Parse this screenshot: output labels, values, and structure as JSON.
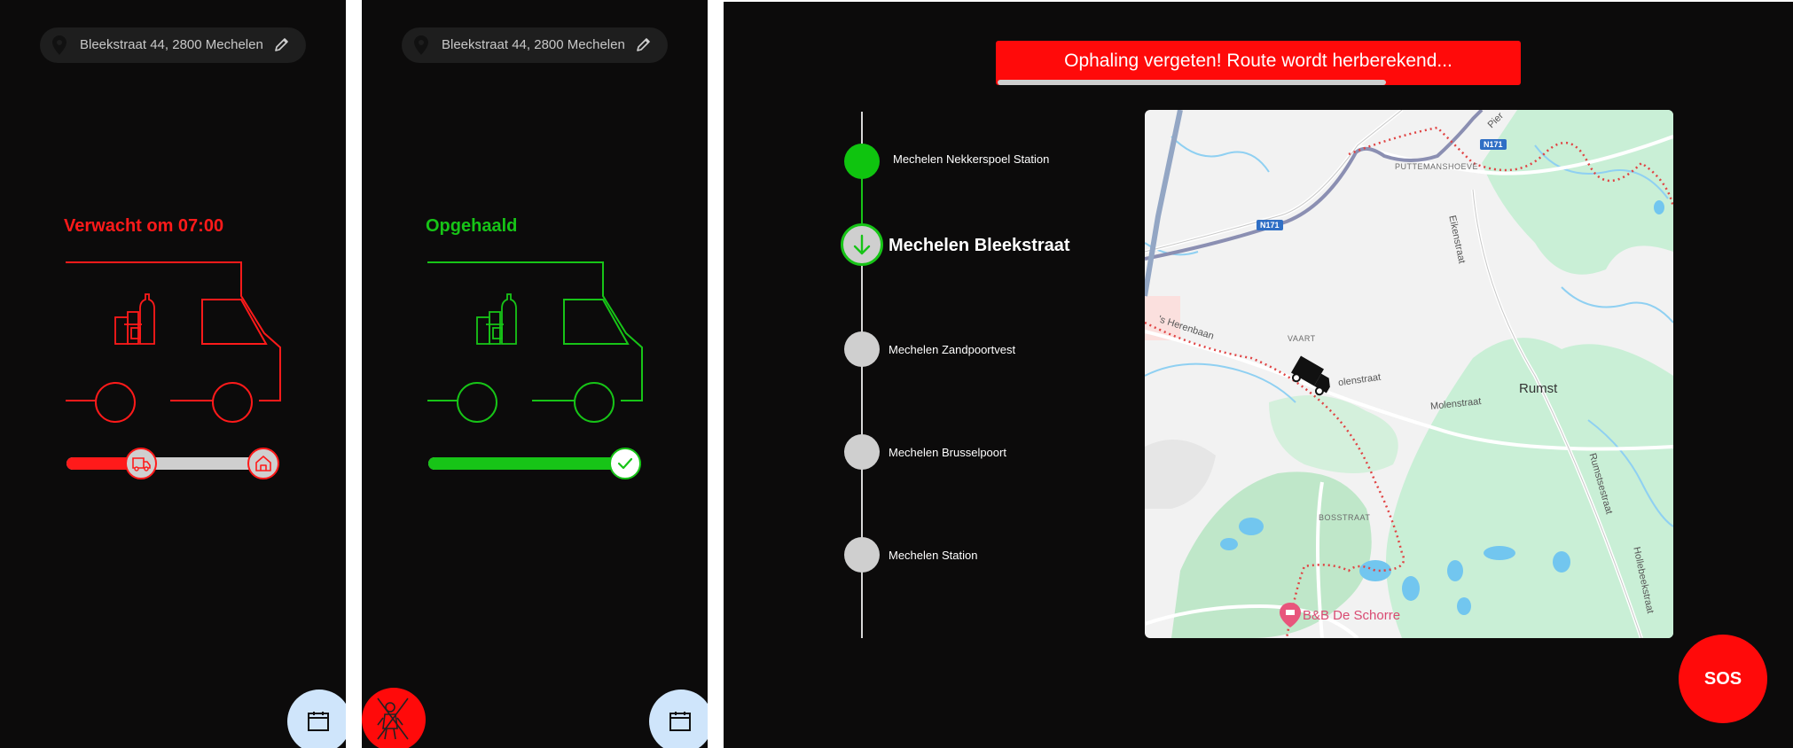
{
  "address": "Bleekstraat 44, 2800 Mechelen",
  "panel_expected": {
    "status": "Verwacht om 07:00",
    "color": "#ff1a1a",
    "progress": 0.35
  },
  "panel_collected": {
    "status": "Opgehaald",
    "color": "#17c417",
    "progress": 1.0
  },
  "alert": {
    "text": "Ophaling vergeten! Route wordt herberekend...",
    "progress": 0.74
  },
  "route": {
    "stops": [
      {
        "label": "Mechelen Nekkerspoel Station",
        "state": "done"
      },
      {
        "label": "Mechelen Bleekstraat",
        "state": "current"
      },
      {
        "label": "Mechelen Zandpoortvest",
        "state": "upcoming"
      },
      {
        "label": "Mechelen Brusselpoort",
        "state": "upcoming"
      },
      {
        "label": "Mechelen Station",
        "state": "upcoming"
      }
    ]
  },
  "map": {
    "labels": {
      "n171_a": "N171",
      "n171_b": "N171",
      "puttemanshoeve": "PUTTEMANSHOEVE",
      "eikenstraat": "Eikenstraat",
      "pier": "Pier",
      "vaart": "VAART",
      "herenbaan": "'s Herenbaan",
      "molenstraat_a": "olenstraat",
      "molenstraat_b": "Molenstraat",
      "rumst": "Rumst",
      "rumstsestraat": "Rumstsestraat",
      "bosstraat": "BOSSTRAAT",
      "hollebeekstraat": "Hollebeekstraat",
      "poi": "B&B De Schorre"
    }
  },
  "sos_label": "SOS",
  "colors": {
    "red": "#ff0a0a",
    "green": "#17c417",
    "background": "#0c0b0b",
    "calendar_button": "#cfe5fb"
  }
}
